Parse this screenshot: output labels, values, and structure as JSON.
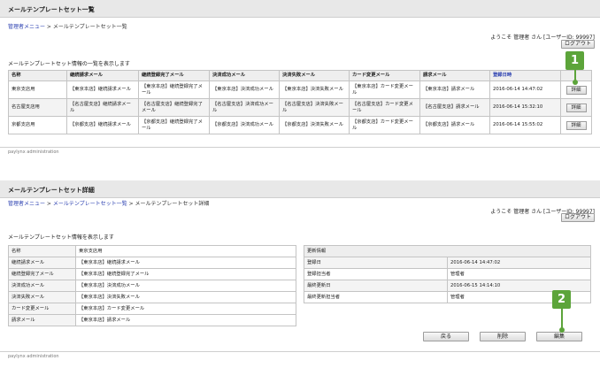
{
  "list_page": {
    "title": "メールテンプレートセット一覧",
    "breadcrumb": {
      "home": "管理者メニュー",
      "separator": " > ",
      "current": "メールテンプレートセット一覧"
    },
    "welcome": "ようこそ 管理者 さん [ユーザーID: 99997]",
    "logout": "ログアウト",
    "description": "メールテンプレートセット情報の一覧を表示します",
    "columns": [
      "名称",
      "継続請求メール",
      "継続登録完了メール",
      "決済成功メール",
      "決済失敗メール",
      "カード変更メール",
      "請求メール",
      "登録日時",
      ""
    ],
    "rows": [
      {
        "name": "東京支店用",
        "cells": [
          "【東京本店】継続請求メール",
          "【東京本店】継続登録完了メール",
          "【東京本店】決済成功メール",
          "【東京本店】決済失敗メール",
          "【東京本店】カード変更メール",
          "【東京本店】請求メール",
          "2016-06-14 14:47:02"
        ],
        "button": "詳細"
      },
      {
        "name": "名古屋支店用",
        "cells": [
          "【名古屋支店】継続請求メール",
          "【名古屋支店】継続登録完了メール",
          "【名古屋支店】決済成功メール",
          "【名古屋支店】決済失敗メール",
          "【名古屋支店】カード変更メール",
          "【名古屋支店】請求メール",
          "2016-06-14 15:32:10"
        ],
        "button": "詳細"
      },
      {
        "name": "京都支店用",
        "cells": [
          "【京都支店】継続請求メール",
          "【京都支店】継続登録完了メール",
          "【京都支店】決済成功メール",
          "【京都支店】決済失敗メール",
          "【京都支店】カード変更メール",
          "【京都支店】請求メール",
          "2016-06-14 15:55:02"
        ],
        "button": "詳細"
      }
    ],
    "footer": "paylynx administration"
  },
  "detail_page": {
    "title": "メールテンプレートセット詳細",
    "breadcrumb": {
      "home": "管理者メニュー",
      "separator": " > ",
      "middle": "メールテンプレートセット一覧",
      "current": "メールテンプレートセット詳細"
    },
    "welcome": "ようこそ 管理者 さん [ユーザーID: 99997]",
    "logout": "ログアウト",
    "description": "メールテンプレートセット情報を表示します",
    "fields": [
      {
        "label": "名称",
        "value": "東京支店用"
      },
      {
        "label": "継続請求メール",
        "value": "【東京本店】継続請求メール"
      },
      {
        "label": "継続登録完了メール",
        "value": "【東京本店】継続登録完了メール"
      },
      {
        "label": "決済成功メール",
        "value": "【東京本店】決済成功メール"
      },
      {
        "label": "決済失敗メール",
        "value": "【東京本店】決済失敗メール"
      },
      {
        "label": "カード変更メール",
        "value": "【東京本店】カード変更メール"
      },
      {
        "label": "請求メール",
        "value": "【東京本店】請求メール"
      }
    ],
    "update_info": {
      "header": "更新情報",
      "rows": [
        {
          "label": "登録日",
          "value": "2016-06-14 14:47:02"
        },
        {
          "label": "登録担当者",
          "value": "管理者"
        },
        {
          "label": "最終更新日",
          "value": "2016-06-15 14:14:10"
        },
        {
          "label": "最終更新担当者",
          "value": "管理者"
        }
      ]
    },
    "buttons": {
      "back": "戻る",
      "delete": "削除",
      "edit": "編集"
    },
    "footer": "paylynx administration"
  },
  "markers": [
    "1",
    "2"
  ],
  "colors": {
    "marker": "#5ca43a",
    "link": "#2a3fb0",
    "titlebar": "#e8e8e8"
  }
}
